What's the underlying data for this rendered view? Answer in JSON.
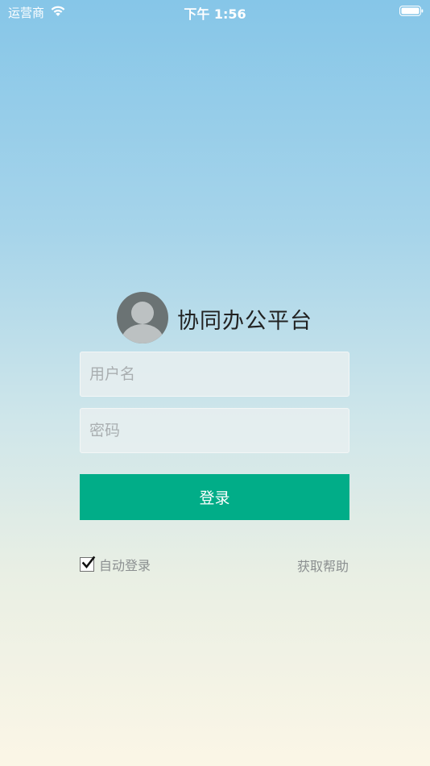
{
  "status_bar": {
    "carrier": "运营商",
    "time": "下午 1:56",
    "wifi_icon": "wifi-icon",
    "battery_icon": "battery-icon"
  },
  "header": {
    "avatar_icon": "avatar-icon",
    "title": "协同办公平台"
  },
  "form": {
    "username": {
      "value": "",
      "placeholder": "用户名"
    },
    "password": {
      "value": "",
      "placeholder": "密码"
    },
    "login_label": "登录"
  },
  "options": {
    "auto_login_label": "自动登录",
    "auto_login_checked": true,
    "help_label": "获取帮助"
  },
  "colors": {
    "primary": "#01ad88",
    "background_top": "#86c6e8",
    "background_bottom": "#fbf6e6"
  }
}
